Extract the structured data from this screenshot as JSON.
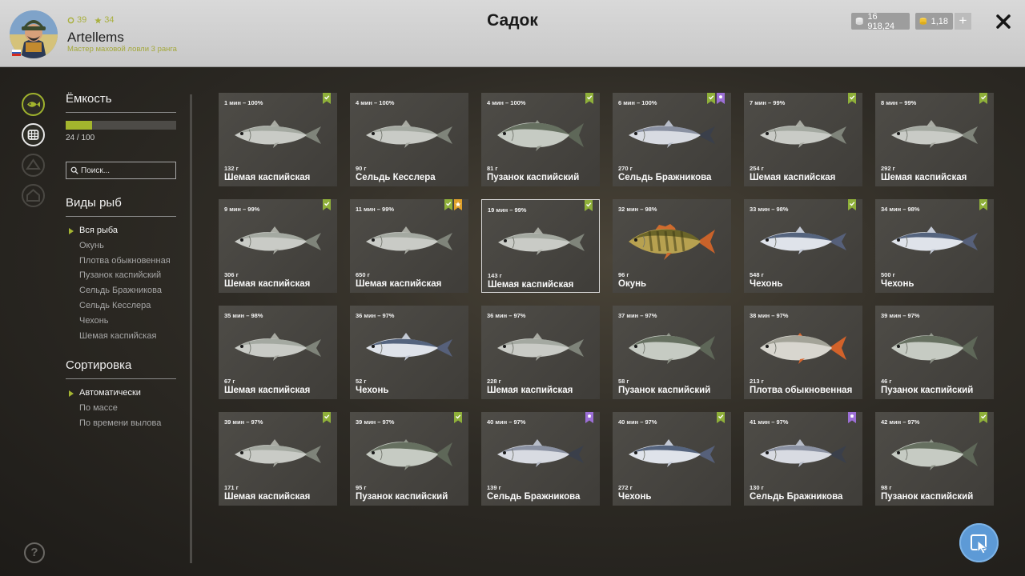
{
  "header": {
    "title": "Садок",
    "player": {
      "name": "Artellems",
      "rank": "Мастер маховой ловли 3 ранга",
      "level_a": "39",
      "level_b": "34"
    },
    "silver": "16 918,24",
    "gold": "1,18",
    "plus_label": "+"
  },
  "sidebar": {
    "icons": [
      "fish-icon",
      "keepnet-icon",
      "camp-icon",
      "house-icon"
    ],
    "help_label": "?"
  },
  "panel": {
    "capacity_title": "Ёмкость",
    "capacity_text": "24 / 100",
    "capacity_fraction": 0.24,
    "search_placeholder": "Поиск...",
    "species_title": "Виды рыб",
    "species": [
      {
        "label": "Вся рыба",
        "active": true
      },
      {
        "label": "Окунь",
        "active": false
      },
      {
        "label": "Плотва обыкновенная",
        "active": false
      },
      {
        "label": "Пузанок каспийский",
        "active": false
      },
      {
        "label": "Сельдь Бражникова",
        "active": false
      },
      {
        "label": "Сельдь Кесслера",
        "active": false
      },
      {
        "label": "Чехонь",
        "active": false
      },
      {
        "label": "Шемая каспийская",
        "active": false
      }
    ],
    "sort_title": "Сортировка",
    "sort": [
      {
        "label": "Автоматически",
        "active": true
      },
      {
        "label": "По массе",
        "active": false
      },
      {
        "label": "По времени вылова",
        "active": false
      }
    ]
  },
  "fish": [
    {
      "time": "1 мин – 100%",
      "weight": "132 г",
      "name": "Шемая каспийская",
      "kind": "shemaya",
      "badges": [
        "green"
      ]
    },
    {
      "time": "4 мин – 100%",
      "weight": "90 г",
      "name": "Сельдь Кесслера",
      "kind": "shemaya",
      "badges": []
    },
    {
      "time": "4 мин – 100%",
      "weight": "81 г",
      "name": "Пузанок каспийский",
      "kind": "puzanok",
      "badges": [
        "green"
      ]
    },
    {
      "time": "6 мин – 100%",
      "weight": "270 г",
      "name": "Сельдь Бражникова",
      "kind": "seld",
      "badges": [
        "green",
        "purple"
      ]
    },
    {
      "time": "7 мин – 99%",
      "weight": "254 г",
      "name": "Шемая каспийская",
      "kind": "shemaya",
      "badges": [
        "green"
      ]
    },
    {
      "time": "8 мин – 99%",
      "weight": "292 г",
      "name": "Шемая каспийская",
      "kind": "shemaya",
      "badges": [
        "green"
      ]
    },
    {
      "time": "9 мин – 99%",
      "weight": "306 г",
      "name": "Шемая каспийская",
      "kind": "shemaya",
      "badges": [
        "green"
      ]
    },
    {
      "time": "11 мин – 99%",
      "weight": "650 г",
      "name": "Шемая каспийская",
      "kind": "shemaya",
      "badges": [
        "green",
        "orange"
      ]
    },
    {
      "time": "19 мин – 99%",
      "weight": "143 г",
      "name": "Шемая каспийская",
      "kind": "shemaya",
      "badges": [
        "green"
      ],
      "selected": true
    },
    {
      "time": "32 мин – 98%",
      "weight": "96 г",
      "name": "Окунь",
      "kind": "perch",
      "badges": []
    },
    {
      "time": "33 мин – 98%",
      "weight": "548 г",
      "name": "Чехонь",
      "kind": "chekhon",
      "badges": [
        "green"
      ]
    },
    {
      "time": "34 мин – 98%",
      "weight": "500 г",
      "name": "Чехонь",
      "kind": "chekhon",
      "badges": [
        "green"
      ]
    },
    {
      "time": "35 мин – 98%",
      "weight": "67 г",
      "name": "Шемая каспийская",
      "kind": "shemaya",
      "badges": []
    },
    {
      "time": "36 мин – 97%",
      "weight": "52 г",
      "name": "Чехонь",
      "kind": "chekhon",
      "badges": []
    },
    {
      "time": "36 мин – 97%",
      "weight": "228 г",
      "name": "Шемая каспийская",
      "kind": "shemaya",
      "badges": []
    },
    {
      "time": "37 мин – 97%",
      "weight": "58 г",
      "name": "Пузанок каспийский",
      "kind": "puzanok",
      "badges": []
    },
    {
      "time": "38 мин – 97%",
      "weight": "213 г",
      "name": "Плотва обыкновенная",
      "kind": "roach",
      "badges": []
    },
    {
      "time": "39 мин – 97%",
      "weight": "46 г",
      "name": "Пузанок каспийский",
      "kind": "puzanok",
      "badges": []
    },
    {
      "time": "39 мин – 97%",
      "weight": "171 г",
      "name": "Шемая каспийская",
      "kind": "shemaya",
      "badges": [
        "green"
      ]
    },
    {
      "time": "39 мин – 97%",
      "weight": "95 г",
      "name": "Пузанок каспийский",
      "kind": "puzanok",
      "badges": [
        "green"
      ]
    },
    {
      "time": "40 мин – 97%",
      "weight": "139 г",
      "name": "Сельдь Бражникова",
      "kind": "seld",
      "badges": [
        "purple"
      ]
    },
    {
      "time": "40 мин – 97%",
      "weight": "272 г",
      "name": "Чехонь",
      "kind": "chekhon",
      "badges": [
        "green"
      ]
    },
    {
      "time": "41 мин – 97%",
      "weight": "130 г",
      "name": "Сельдь Бражникова",
      "kind": "seld",
      "badges": [
        "purple"
      ]
    },
    {
      "time": "42 мин – 97%",
      "weight": "98 г",
      "name": "Пузанок каспийский",
      "kind": "puzanok",
      "badges": [
        "green"
      ]
    }
  ],
  "colors": {
    "accent": "#a3b52d",
    "badge_green": "#8fb03a",
    "badge_purple": "#9c6fd6",
    "badge_orange": "#e0a12a",
    "cursor_button": "#5d9ad6"
  }
}
